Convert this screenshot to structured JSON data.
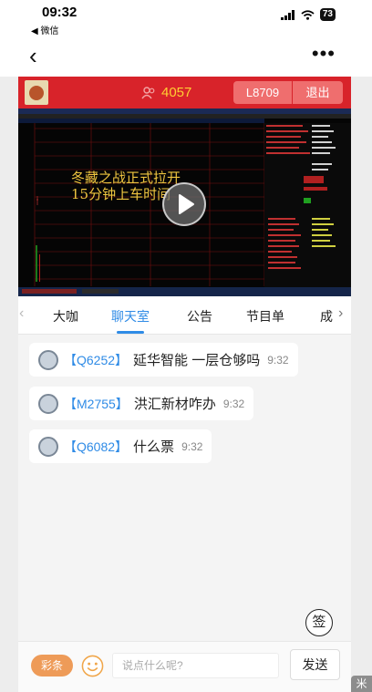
{
  "status": {
    "time": "09:32",
    "back_app": "◀ 微信",
    "battery": "73"
  },
  "nav": {
    "back_glyph": "‹",
    "more_glyph": "•••"
  },
  "live": {
    "viewer_count": "4057",
    "room_id": "L8709",
    "exit_label": "退出",
    "overlay_line1": "冬藏之战正式拉开",
    "overlay_line2": "15分钟上车时间"
  },
  "tabs": [
    {
      "label": "大咖"
    },
    {
      "label": "聊天室",
      "active": true
    },
    {
      "label": "公告"
    },
    {
      "label": "节目单"
    },
    {
      "label": "成"
    }
  ],
  "messages": [
    {
      "uid": "【Q6252】",
      "text": "延华智能 一层仓够吗",
      "time": "9:32"
    },
    {
      "uid": "【M2755】",
      "text": "洪汇新材咋办",
      "time": "9:32"
    },
    {
      "uid": "【Q6082】",
      "text": "什么票",
      "time": "9:32"
    }
  ],
  "sign_label": "签",
  "input_bar": {
    "caitiao_label": "彩条",
    "placeholder": "说点什么呢?",
    "send_label": "发送"
  },
  "corner_badge": "米",
  "colors": {
    "accent": "#d8232a",
    "tab_active": "#2f8be6",
    "viewer": "#ffcf33",
    "caitiao": "#ee9b58"
  }
}
